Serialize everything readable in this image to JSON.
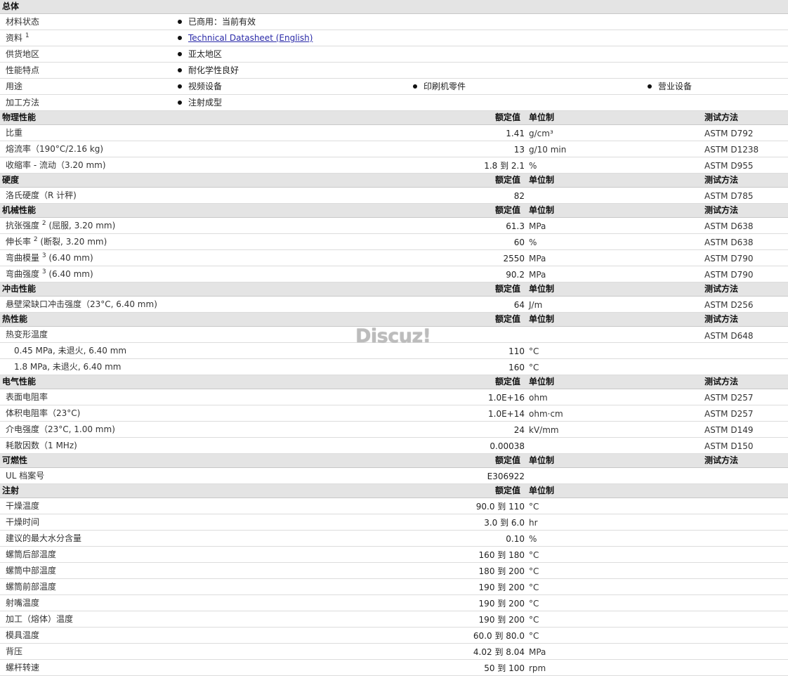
{
  "general": {
    "title": "总体",
    "status": {
      "label": "材料状态",
      "value": "已商用：当前有效"
    },
    "docs": {
      "label": "资料",
      "sup": "1",
      "link": "Technical Datasheet (English)"
    },
    "region": {
      "label": "供货地区",
      "value": "亚太地区"
    },
    "features": {
      "label": "性能特点",
      "value": "耐化学性良好"
    },
    "uses": {
      "label": "用途",
      "values": [
        "视频设备",
        "印刷机零件",
        "营业设备"
      ]
    },
    "process": {
      "label": "加工方法",
      "value": "注射成型"
    }
  },
  "headers": {
    "nominal": "额定值",
    "unit": "单位制",
    "test": "测试方法"
  },
  "physical": {
    "title": "物理性能",
    "rows": [
      {
        "label": "比重",
        "value": "1.41",
        "unit": "g/cm³",
        "method": "ASTM D792"
      },
      {
        "label": "熔流率（190°C/2.16 kg)",
        "value": "13",
        "unit": "g/10 min",
        "method": "ASTM D1238"
      },
      {
        "label": "收缩率 - 流动（3.20 mm)",
        "value": "1.8 到  2.1",
        "unit": "%",
        "method": "ASTM D955"
      }
    ]
  },
  "hardness": {
    "title": "硬度",
    "rows": [
      {
        "label": "洛氏硬度（R 计秤)",
        "value": "82",
        "unit": "",
        "method": "ASTM D785"
      }
    ]
  },
  "mechanical": {
    "title": "机械性能",
    "rows": [
      {
        "label": "抗张强度",
        "sup": "2",
        "cond": "(屈服, 3.20 mm)",
        "value": "61.3",
        "unit": "MPa",
        "method": "ASTM D638"
      },
      {
        "label": "伸长率",
        "sup": "2",
        "cond": "(断裂, 3.20 mm)",
        "value": "60",
        "unit": "%",
        "method": "ASTM D638"
      },
      {
        "label": "弯曲模量",
        "sup": "3",
        "cond": "(6.40 mm)",
        "value": "2550",
        "unit": "MPa",
        "method": "ASTM D790"
      },
      {
        "label": "弯曲强度",
        "sup": "3",
        "cond": "(6.40 mm)",
        "value": "90.2",
        "unit": "MPa",
        "method": "ASTM D790"
      }
    ]
  },
  "impact": {
    "title": "冲击性能",
    "rows": [
      {
        "label": "悬壁梁缺口冲击强度（23°C, 6.40 mm)",
        "value": "64",
        "unit": "J/m",
        "method": "ASTM D256"
      }
    ]
  },
  "thermal": {
    "title": "热性能",
    "heading": {
      "label": "热变形温度",
      "method": "ASTM D648"
    },
    "rows": [
      {
        "label": "0.45 MPa, 未退火, 6.40 mm",
        "value": "110",
        "unit": "°C"
      },
      {
        "label": "1.8 MPa, 未退火, 6.40 mm",
        "value": "160",
        "unit": "°C"
      }
    ]
  },
  "electrical": {
    "title": "电气性能",
    "rows": [
      {
        "label": "表面电阻率",
        "value": "1.0E+16",
        "unit": "ohm",
        "method": "ASTM D257"
      },
      {
        "label": "体积电阻率（23°C)",
        "value": "1.0E+14",
        "unit": "ohm·cm",
        "method": "ASTM D257"
      },
      {
        "label": "介电强度（23°C, 1.00 mm)",
        "value": "24",
        "unit": "kV/mm",
        "method": "ASTM D149"
      },
      {
        "label": "耗散因数（1 MHz)",
        "value": "0.00038",
        "unit": "",
        "method": "ASTM D150"
      }
    ]
  },
  "flammability": {
    "title": "可燃性",
    "rows": [
      {
        "label": "UL 档案号",
        "value": "E306922",
        "unit": "",
        "method": ""
      }
    ]
  },
  "injection": {
    "title": "注射",
    "rows": [
      {
        "label": "干燥温度",
        "value": "90.0 到  110",
        "unit": "°C"
      },
      {
        "label": "干燥时间",
        "value": "3.0 到  6.0",
        "unit": "hr"
      },
      {
        "label": "建议的最大水分含量",
        "value": "0.10",
        "unit": "%"
      },
      {
        "label": "螺筒后部温度",
        "value": "160 到  180",
        "unit": "°C"
      },
      {
        "label": "螺筒中部温度",
        "value": "180 到  200",
        "unit": "°C"
      },
      {
        "label": "螺筒前部温度",
        "value": "190 到  200",
        "unit": "°C"
      },
      {
        "label": "射嘴温度",
        "value": "190 到  200",
        "unit": "°C"
      },
      {
        "label": "加工（熔体）温度",
        "value": "190 到  200",
        "unit": "°C"
      },
      {
        "label": "模具温度",
        "value": "60.0 到  80.0",
        "unit": "°C"
      },
      {
        "label": "背压",
        "value": "4.02 到  8.04",
        "unit": "MPa"
      },
      {
        "label": "螺杆转速",
        "value": "50 到  100",
        "unit": "rpm"
      }
    ]
  },
  "watermark": "Discuz!"
}
